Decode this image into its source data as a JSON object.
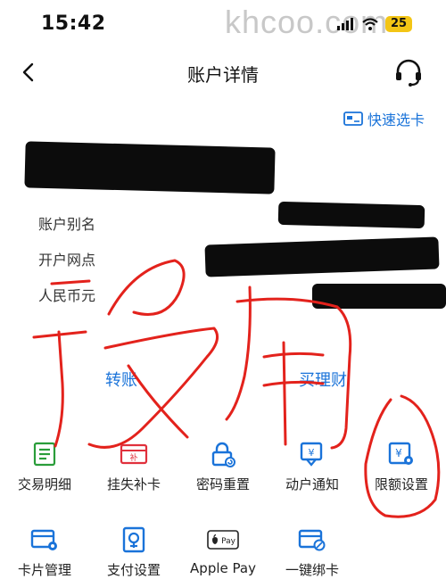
{
  "status_bar": {
    "time": "15:42",
    "watermark": "khcoo.com",
    "battery": "25"
  },
  "nav": {
    "title": "账户详情"
  },
  "quick_card": {
    "label": "快速选卡"
  },
  "account_info": {
    "alias_label": "账户别名",
    "branch_label": "开户网点",
    "currency_label": "人民币元"
  },
  "actions": {
    "transfer": "转账",
    "wealth": "买理财"
  },
  "services": [
    {
      "label": "交易明细",
      "icon": "list-icon",
      "color": "#2a9d3a"
    },
    {
      "label": "挂失补卡",
      "icon": "lost-card-icon",
      "color": "#e0303c"
    },
    {
      "label": "密码重置",
      "icon": "lock-reset-icon",
      "color": "#1a73d9"
    },
    {
      "label": "动户通知",
      "icon": "notification-icon",
      "color": "#1a73d9"
    },
    {
      "label": "限额设置",
      "icon": "limit-setting-icon",
      "color": "#1a73d9"
    },
    {
      "label": "卡片管理",
      "icon": "card-manage-icon",
      "color": "#1a73d9"
    },
    {
      "label": "支付设置",
      "icon": "payment-setting-icon",
      "color": "#1a73d9"
    },
    {
      "label": "Apple Pay",
      "icon": "apple-pay-icon",
      "color": "#222222"
    },
    {
      "label": "一键绑卡",
      "icon": "bind-card-icon",
      "color": "#1a73d9"
    }
  ],
  "colors": {
    "accent": "#1a73d9",
    "scribble": "#e3221c"
  }
}
